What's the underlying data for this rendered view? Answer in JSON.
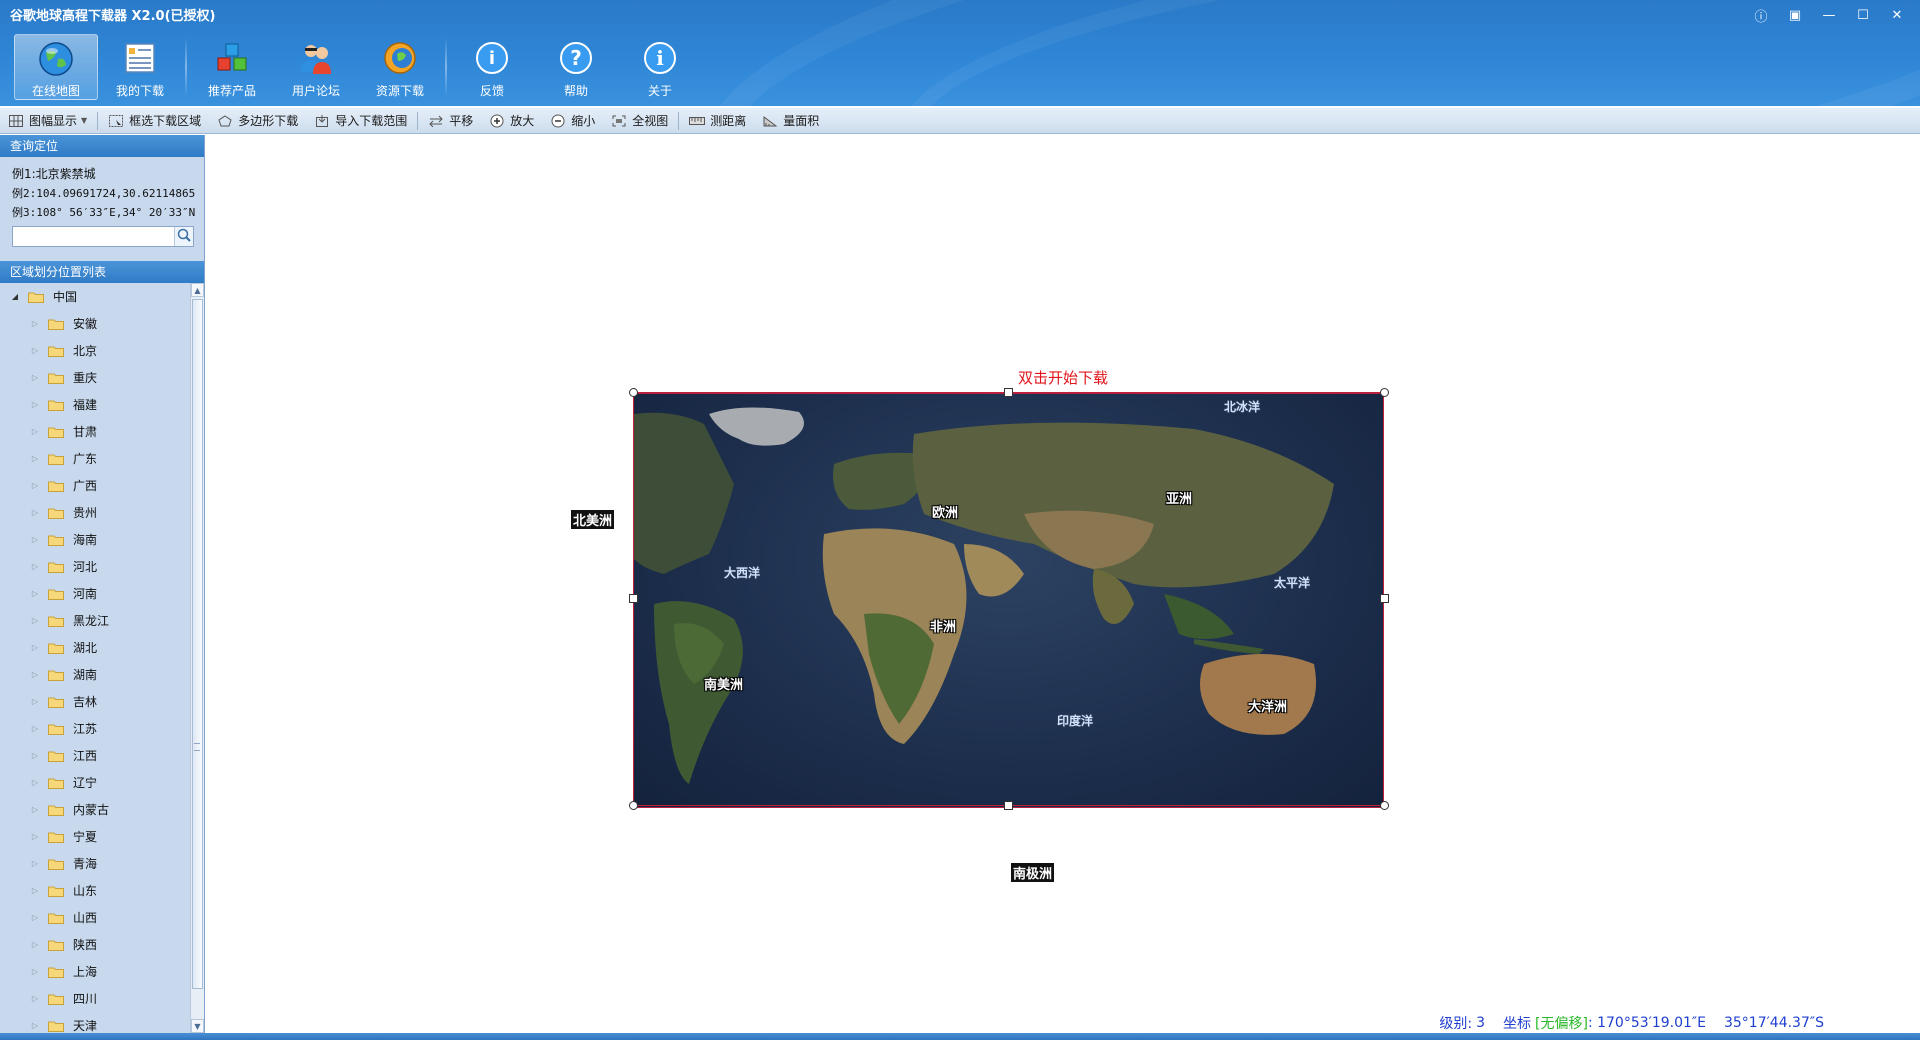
{
  "window": {
    "title": "谷歌地球高程下载器 X2.0(已授权)",
    "controls": [
      "ⓘ",
      "▣",
      "—",
      "☐",
      "✕"
    ]
  },
  "toolbar": {
    "buttons": [
      {
        "label": "在线地图",
        "icon": "globe-icon",
        "active": true
      },
      {
        "label": "我的下载",
        "icon": "download-list-icon",
        "active": false
      },
      {
        "label": "推荐产品",
        "icon": "cubes-icon",
        "active": false
      },
      {
        "label": "用户论坛",
        "icon": "users-icon",
        "active": false
      },
      {
        "label": "资源下载",
        "icon": "resource-globe-icon",
        "active": false
      },
      {
        "label": "反馈",
        "icon": "feedback-icon",
        "active": false
      },
      {
        "label": "帮助",
        "icon": "help-icon",
        "active": false
      },
      {
        "label": "关于",
        "icon": "info-icon",
        "active": false
      }
    ]
  },
  "toolstrip": {
    "items": [
      {
        "label": "图幅显示",
        "icon": "grid-icon",
        "dropdown": true
      },
      {
        "label": "框选下载区域",
        "icon": "rect-select-icon"
      },
      {
        "label": "多边形下载",
        "icon": "polygon-icon"
      },
      {
        "label": "导入下载范围",
        "icon": "import-icon"
      },
      {
        "label": "平移",
        "icon": "pan-icon"
      },
      {
        "label": "放大",
        "icon": "zoom-in-icon"
      },
      {
        "label": "缩小",
        "icon": "zoom-out-icon"
      },
      {
        "label": "全视图",
        "icon": "full-extent-icon"
      },
      {
        "label": "测距离",
        "icon": "measure-distance-icon"
      },
      {
        "label": "量面积",
        "icon": "measure-area-icon"
      }
    ]
  },
  "query": {
    "title": "查询定位",
    "examples": [
      "例1:北京紫禁城",
      "例2:104.09691724,30.62114865",
      "例3:108° 56′33″E,34° 20′33″N"
    ],
    "input_value": "",
    "input_placeholder": ""
  },
  "region": {
    "title": "区域划分位置列表",
    "root": "中国",
    "provinces": [
      "安徽",
      "北京",
      "重庆",
      "福建",
      "甘肃",
      "广东",
      "广西",
      "贵州",
      "海南",
      "河北",
      "河南",
      "黑龙江",
      "湖北",
      "湖南",
      "吉林",
      "江苏",
      "江西",
      "辽宁",
      "内蒙古",
      "宁夏",
      "青海",
      "山东",
      "山西",
      "陕西",
      "上海",
      "四川",
      "天津"
    ]
  },
  "map": {
    "hint": "双击开始下载",
    "labels": {
      "north_america": "北美洲",
      "europe": "欧洲",
      "asia": "亚洲",
      "africa": "非洲",
      "south_america": "南美洲",
      "oceania": "大洋洲",
      "antarctica": "南极洲",
      "atlantic": "大西洋",
      "pacific": "太平洋",
      "indian": "印度洋",
      "arctic": "北冰洋"
    }
  },
  "status": {
    "level_label": "级别:",
    "level_value": "3",
    "coord_label": "坐标",
    "offset_tag": "[无偏移]",
    "lon": ": 170°53′19.01″E",
    "lat": "35°17′44.37″S"
  }
}
